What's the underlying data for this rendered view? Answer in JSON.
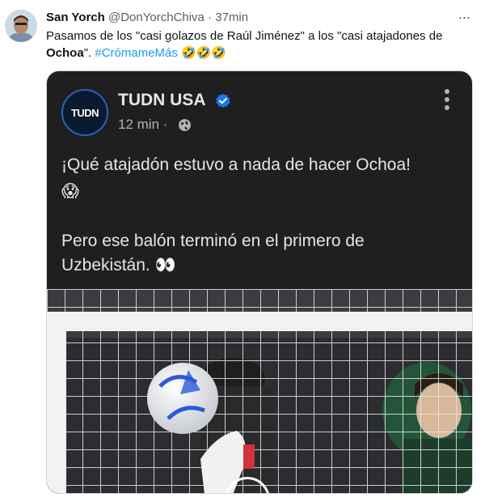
{
  "tweet": {
    "display_name": "San Yorch",
    "handle": "@DonYorchChiva",
    "separator": "·",
    "time": "37min",
    "more_label": "···",
    "text_part1": "Pasamos de los \"casi golazos de Raúl Jiménez\" a los \"casi atajadones de ",
    "text_bold": "Ochoa",
    "text_part2": "\". ",
    "hashtag": "#CrómameMás",
    "emojis": "🤣🤣🤣"
  },
  "embedded_post": {
    "page_name": "TUDN USA",
    "logo_text": "TUDN",
    "time": "12 min ·",
    "line1": "¡Qué atajadón estuvo a nada de hacer Ochoa!",
    "line2_emoji": "😱",
    "line3": "Pero ese balón terminó en el primero de",
    "line4": "Uzbekistán. 👀"
  },
  "colors": {
    "accent": "#1d9bf0",
    "verified": "#1877f2",
    "dark_bg": "#1f1f20"
  },
  "icons": [
    "more-icon",
    "verified-badge-icon",
    "globe-icon",
    "play-icon"
  ]
}
